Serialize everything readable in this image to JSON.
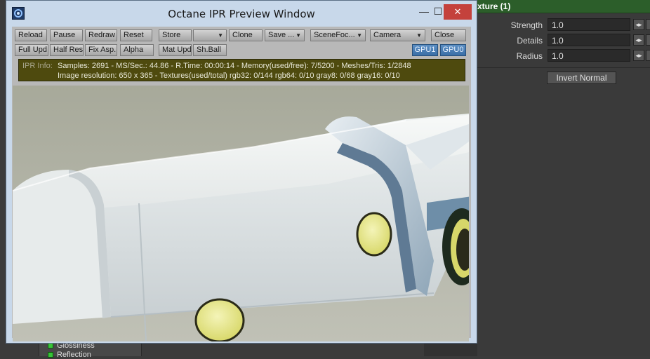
{
  "host": {
    "panel_title": "xture (1)",
    "properties": [
      {
        "label": "Strength",
        "value": "1.0"
      },
      {
        "label": "Details",
        "value": "1.0"
      },
      {
        "label": "Radius",
        "value": "1.0"
      }
    ],
    "invert_normal_label": "Invert Normal",
    "nodes": [
      "Glossiness",
      "Reflection"
    ]
  },
  "window": {
    "title": "Octane IPR Preview Window",
    "minimize_glyph": "—",
    "maximize_glyph": "☐",
    "close_glyph": "✕"
  },
  "toolbar": {
    "row1": {
      "reload": "Reload",
      "pause": "Pause",
      "redraw": "Redraw",
      "reset": "Reset",
      "store": "Store",
      "store_select": "",
      "clone": "Clone",
      "save": "Save ...",
      "scene_focus": "SceneFoc...",
      "camera": "Camera",
      "close": "Close"
    },
    "row2": {
      "full_upd": "Full Upd.",
      "half_res": "Half Res",
      "fix_asp": "Fix Asp.",
      "alpha": "Alpha",
      "mat_upd": "Mat Upd",
      "sh_ball": "Sh.Ball",
      "gpu1": "GPU1",
      "gpu0": "GPU0"
    }
  },
  "ipr_info": {
    "tag": "IPR Info:",
    "line1": "Samples: 2691  -  MS/Sec.: 44.86  -  R.Time: 00:00:14 - Memory(used/free): 7/5200  -  Meshes/Tris: 1/2848",
    "line2": "Image resolution: 650 x 365 - Textures(used/total) rgb32: 0/144   rgb64: 0/10   gray8: 0/68   gray16: 0/10"
  },
  "colors": {
    "titlebar": "#c8d8ea",
    "close_button": "#c4413c",
    "gpu_button": "#4a7fb6",
    "info_bar": "#4e4a0e",
    "host_header": "#2c5e2a",
    "render_yellow": "#e6e68a"
  }
}
